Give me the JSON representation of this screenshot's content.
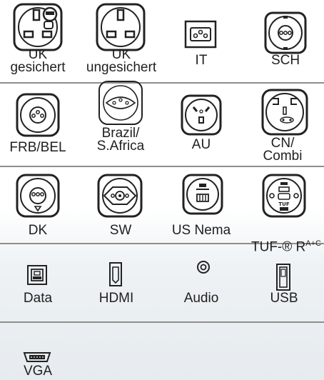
{
  "rows": [
    {
      "items": [
        {
          "label": "UK\ngesichert"
        },
        {
          "label": "UK\nungesichert"
        },
        {
          "label": "IT"
        },
        {
          "label": "SCH"
        }
      ]
    },
    {
      "items": [
        {
          "label": "FRB/BEL"
        },
        {
          "label": "Brazil/\nS.Africa"
        },
        {
          "label": "AU"
        },
        {
          "label": "CN/\nCombi"
        }
      ]
    },
    {
      "items": [
        {
          "label": "DK"
        },
        {
          "label": "SW"
        },
        {
          "label": "US Nema"
        },
        {
          "label": "TUF-® R"
        },
        {
          "label_sup": "A+C"
        }
      ]
    },
    {
      "items": [
        {
          "label": "Data"
        },
        {
          "label": "HDMI"
        },
        {
          "label": "Audio"
        },
        {
          "label": "USB"
        }
      ]
    },
    {
      "items": [
        {
          "label": "VGA"
        }
      ]
    }
  ],
  "icons": {
    "uk_secured": "uk-socket-secured-icon",
    "uk_unsecured": "uk-socket-unsecured-icon",
    "it": "italian-socket-icon",
    "sch": "schuko-socket-icon",
    "frb": "french-belgian-socket-icon",
    "brazil": "brazil-socket-icon",
    "au": "australian-socket-icon",
    "cn": "chinese-combi-socket-icon",
    "dk": "danish-socket-icon",
    "sw": "swiss-socket-icon",
    "us": "us-nema-socket-icon",
    "tuf": "tuf-socket-icon",
    "data": "ethernet-port-icon",
    "hdmi": "hdmi-port-icon",
    "audio": "audio-jack-icon",
    "usb": "usb-port-icon",
    "vga": "vga-port-icon"
  }
}
